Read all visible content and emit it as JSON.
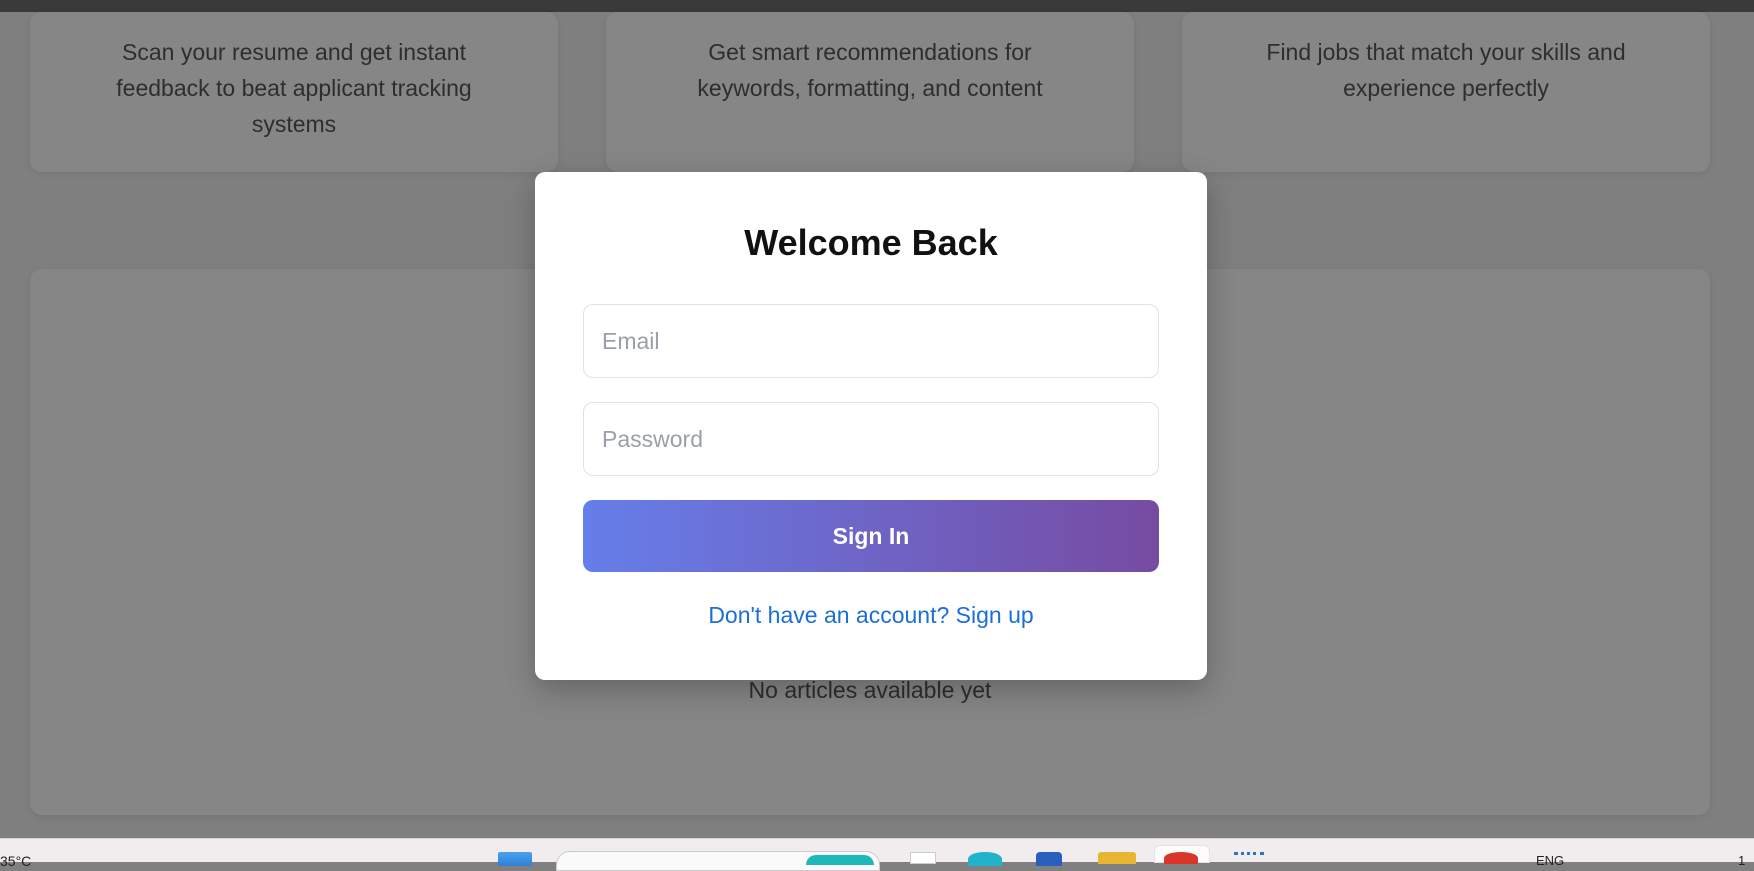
{
  "features": [
    {
      "description": "Scan your resume and get instant feedback to beat applicant tracking systems"
    },
    {
      "description": "Get smart recommendations for keywords, formatting, and content"
    },
    {
      "description": "Find jobs that match your skills and experience perfectly"
    }
  ],
  "articles": {
    "empty_text": "No articles available yet"
  },
  "login_modal": {
    "title": "Welcome Back",
    "email_placeholder": "Email",
    "email_value": "",
    "password_placeholder": "Password",
    "password_value": "",
    "submit_label": "Sign In",
    "signup_link": "Don't have an account? Sign up",
    "button_gradient": [
      "#667eea",
      "#764ba2"
    ],
    "link_color": "#1a6fd6"
  },
  "taskbar": {
    "weather": "35°C",
    "language": "ENG",
    "time": "1",
    "icons": [
      "windows-start-icon",
      "search-box",
      "taskview-icon",
      "edge-icon",
      "store-icon",
      "file-explorer-icon",
      "chrome-icon",
      "app-icon"
    ]
  }
}
